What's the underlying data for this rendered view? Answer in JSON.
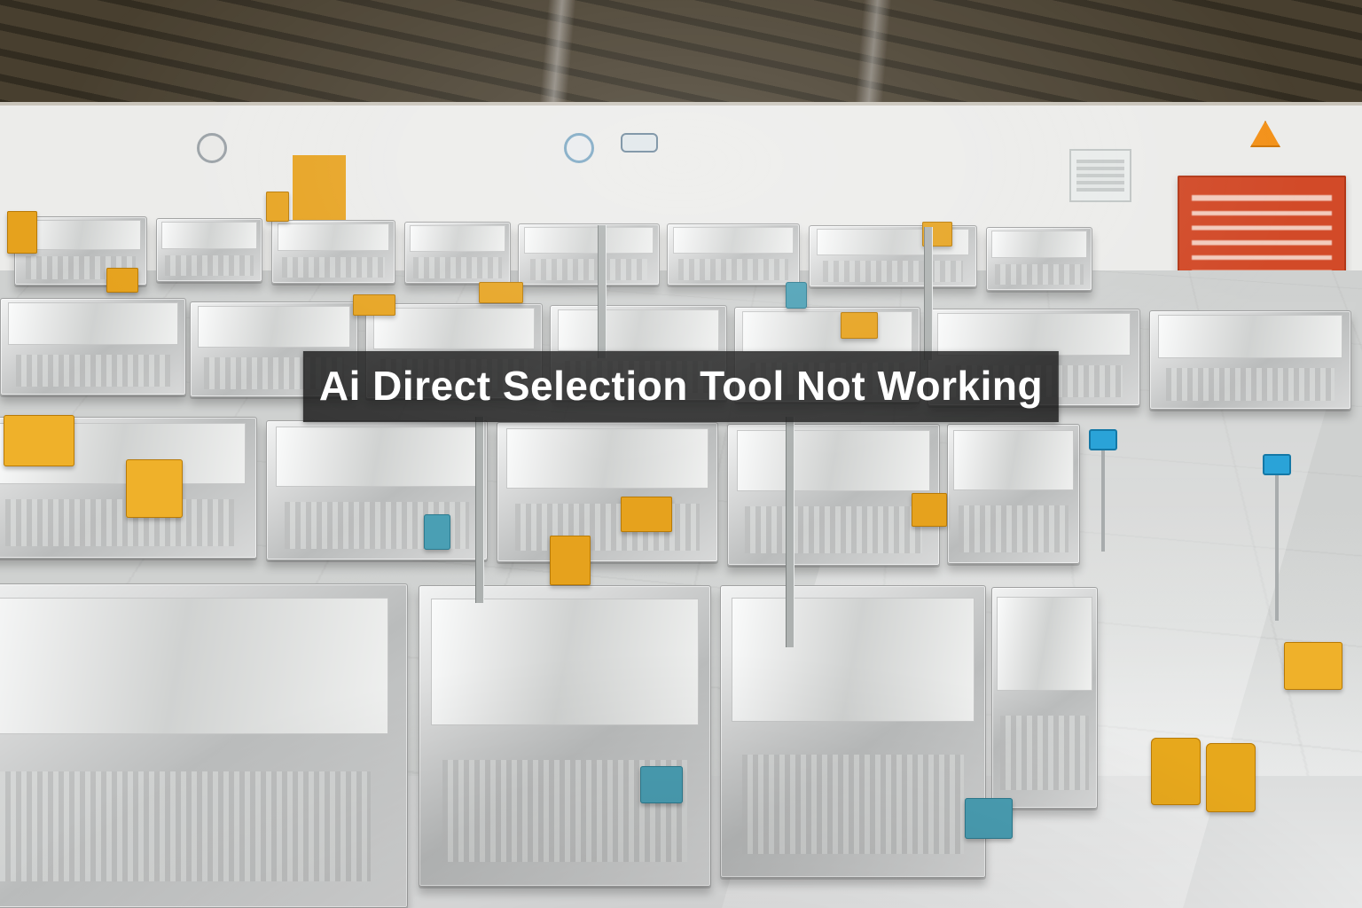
{
  "caption": {
    "text": "Ai Direct Selection Tool Not Working"
  },
  "scene": {
    "accent_yellow": "#e7a21e",
    "accent_teal": "#4a9fb4",
    "sign_orange": "#d24a28"
  }
}
